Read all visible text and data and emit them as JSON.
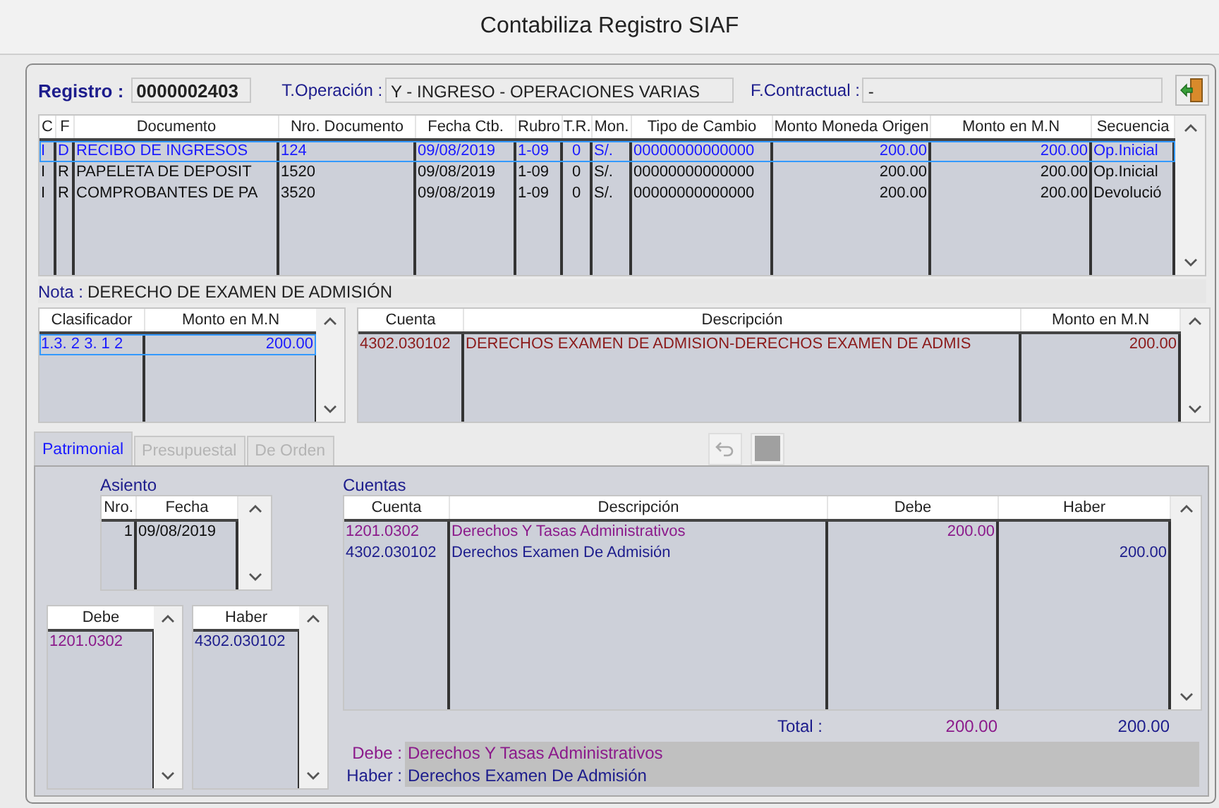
{
  "window": {
    "title": "Contabiliza Registro SIAF"
  },
  "header": {
    "registro_label": "Registro :",
    "registro": "0000002403",
    "operacion_label": "T.Operación :",
    "operacion": "Y  - INGRESO - OPERACIONES VARIAS",
    "contractual_label": "F.Contractual :",
    "contractual": "-"
  },
  "documents": {
    "columns": [
      "C",
      "F",
      "Documento",
      "Nro. Documento",
      "Fecha Ctb.",
      "Rubro",
      "T.R.",
      "Mon.",
      "Tipo de Cambio",
      "Monto Moneda Origen",
      "Monto en M.N",
      "Secuencia"
    ],
    "rows": [
      {
        "selected": true,
        "cells": [
          "I",
          "D",
          "RECIBO DE INGRESOS",
          "124",
          "09/08/2019",
          "1-09",
          "0",
          "S/.",
          "00000000000000",
          "200.00",
          "200.00",
          "Op.Inicial"
        ]
      },
      {
        "selected": false,
        "cells": [
          "I",
          "R",
          "PAPELETA DE DEPOSIT",
          "1520",
          "09/08/2019",
          "1-09",
          "0",
          "S/.",
          "00000000000000",
          "200.00",
          "200.00",
          "Op.Inicial"
        ]
      },
      {
        "selected": false,
        "cells": [
          "I",
          "R",
          "COMPROBANTES DE PA",
          "3520",
          "09/08/2019",
          "1-09",
          "0",
          "S/.",
          "00000000000000",
          "200.00",
          "200.00",
          "Devolució"
        ]
      }
    ]
  },
  "nota": {
    "label": "Nota :",
    "value": "DERECHO DE EXAMEN DE ADMISIÓN"
  },
  "clasificadores": {
    "columns": [
      "Clasificador",
      "Monto en M.N"
    ],
    "rows": [
      {
        "selected": true,
        "cells": [
          "1.3. 2 3. 1 2",
          "200.00"
        ]
      }
    ]
  },
  "cuentas_presupuesto": {
    "columns": [
      "Cuenta",
      "Descripción",
      "Monto en M.N"
    ],
    "rows": [
      {
        "cells": [
          "4302.030102",
          "DERECHOS EXAMEN DE ADMISION-DERECHOS EXAMEN DE ADMIS",
          "200.00"
        ]
      }
    ]
  },
  "tabs": [
    {
      "label": "Patrimonial",
      "selected": true,
      "disabled": false
    },
    {
      "label": "Presupuestal",
      "selected": false,
      "disabled": true
    },
    {
      "label": "De Orden",
      "selected": false,
      "disabled": true
    }
  ],
  "asiento": {
    "label": "Asiento",
    "columns": [
      "Nro.",
      "Fecha"
    ],
    "rows": [
      {
        "cells": [
          "1",
          "09/08/2019"
        ]
      }
    ]
  },
  "debe_list": {
    "columns": [
      "Debe"
    ],
    "rows": [
      {
        "cells": [
          "1201.0302"
        ]
      }
    ]
  },
  "haber_list": {
    "columns": [
      "Haber"
    ],
    "rows": [
      {
        "cells": [
          "4302.030102"
        ]
      }
    ]
  },
  "cuentas": {
    "label": "Cuentas",
    "columns": [
      "Cuenta",
      "Descripción",
      "Debe",
      "Haber"
    ],
    "rows": [
      {
        "kind": "debe",
        "cells": [
          "1201.0302",
          "Derechos Y Tasas Administrativos",
          "200.00",
          ""
        ]
      },
      {
        "kind": "haber",
        "cells": [
          "4302.030102",
          "Derechos Examen De Admisión",
          "",
          "200.00"
        ]
      }
    ]
  },
  "total": {
    "label": "Total :",
    "debe": "200.00",
    "haber": "200.00"
  },
  "summary": [
    {
      "kind": "debe",
      "label": "Debe :",
      "value": "Derechos Y Tasas Administrativos"
    },
    {
      "kind": "haber",
      "label": "Haber :",
      "value": "Derechos Examen De Admisión"
    }
  ]
}
